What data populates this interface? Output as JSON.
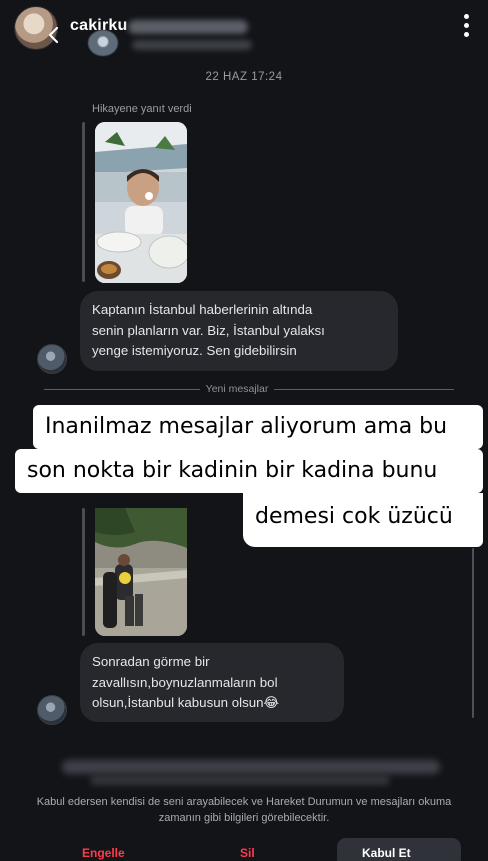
{
  "header": {
    "username": "cakirku",
    "back_icon": "chevron-left-icon",
    "more_icon": "more-vertical-icon"
  },
  "thread": {
    "timestamp": "22 HAZ 17:24",
    "reply_label": "Hikayene yanıt verdi",
    "message1_lines": [
      "Kaptanın İstanbul haberlerinin altında",
      "senin planların var. Biz, İstanbul yalaksı",
      "yenge istemiyoruz. Sen gidebilirsin"
    ],
    "divider_label": "Yeni mesajlar",
    "message2_lines": [
      "Sonradan görme bir",
      "zavallısın,boynuzlanmaların bol",
      "olsun,İstanbul kabusun olsun😂"
    ]
  },
  "overlay_caption": {
    "line1": "Inanilmaz mesajlar aliyorum ama bu",
    "line2": "son nokta bir kadinin bir kadina bunu",
    "line3": "demesi cok üzücü"
  },
  "request": {
    "info_text": "Kabul edersen kendisi de seni arayabilecek ve Hareket Durumun ve mesajları okuma zamanın gibi bilgileri görebilecektir.",
    "report_label": "Engelle",
    "delete_label": "Sil",
    "accept_label": "Kabul Et"
  },
  "colors": {
    "background": "#121418",
    "bubble": "#26282d",
    "danger": "#ff3b4e",
    "caption_bg": "#ffffff"
  }
}
